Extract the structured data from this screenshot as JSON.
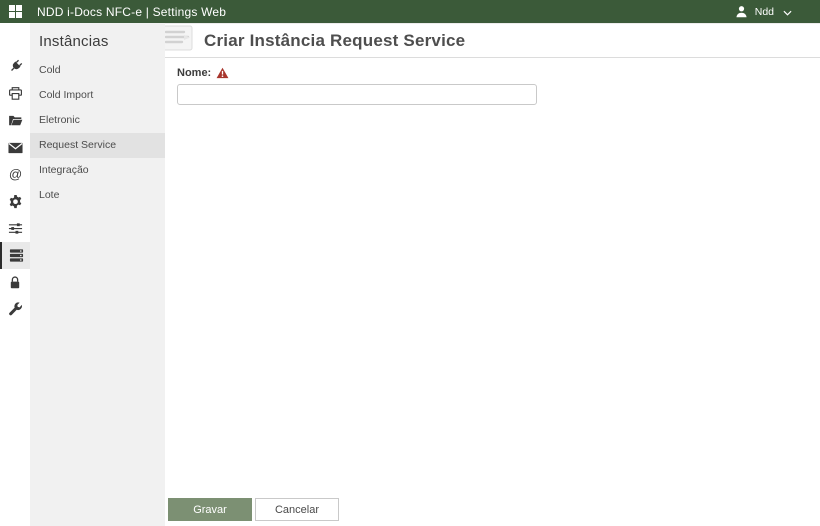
{
  "topbar": {
    "title": "NDD i-Docs NFC-e | Settings Web",
    "user_name": "Ndd",
    "bar_color": "#3b5a39"
  },
  "rail": {
    "icons": [
      {
        "name": "plug-icon",
        "selected": false
      },
      {
        "name": "printer-icon",
        "selected": false
      },
      {
        "name": "folder-open-icon",
        "selected": false
      },
      {
        "name": "mail-icon",
        "selected": false
      },
      {
        "name": "at-sign-icon",
        "selected": false
      },
      {
        "name": "gear-icon",
        "selected": false
      },
      {
        "name": "sliders-icon",
        "selected": false
      },
      {
        "name": "server-stack-icon",
        "selected": true
      },
      {
        "name": "lock-icon",
        "selected": false
      },
      {
        "name": "wrench-icon",
        "selected": false
      }
    ]
  },
  "sidebar": {
    "heading": "Instâncias",
    "items": [
      {
        "label": "Cold",
        "selected": false
      },
      {
        "label": "Cold Import",
        "selected": false
      },
      {
        "label": "Eletronic",
        "selected": false
      },
      {
        "label": "Request Service",
        "selected": true
      },
      {
        "label": "Integração",
        "selected": false
      },
      {
        "label": "Lote",
        "selected": false
      }
    ]
  },
  "main": {
    "title": "Criar Instância Request Service",
    "form": {
      "name_label": "Nome:",
      "name_value": "",
      "required_marker": "warning-triangle"
    },
    "buttons": {
      "save": "Gravar",
      "cancel": "Cancelar"
    },
    "accent_button_color": "#7c9073"
  }
}
